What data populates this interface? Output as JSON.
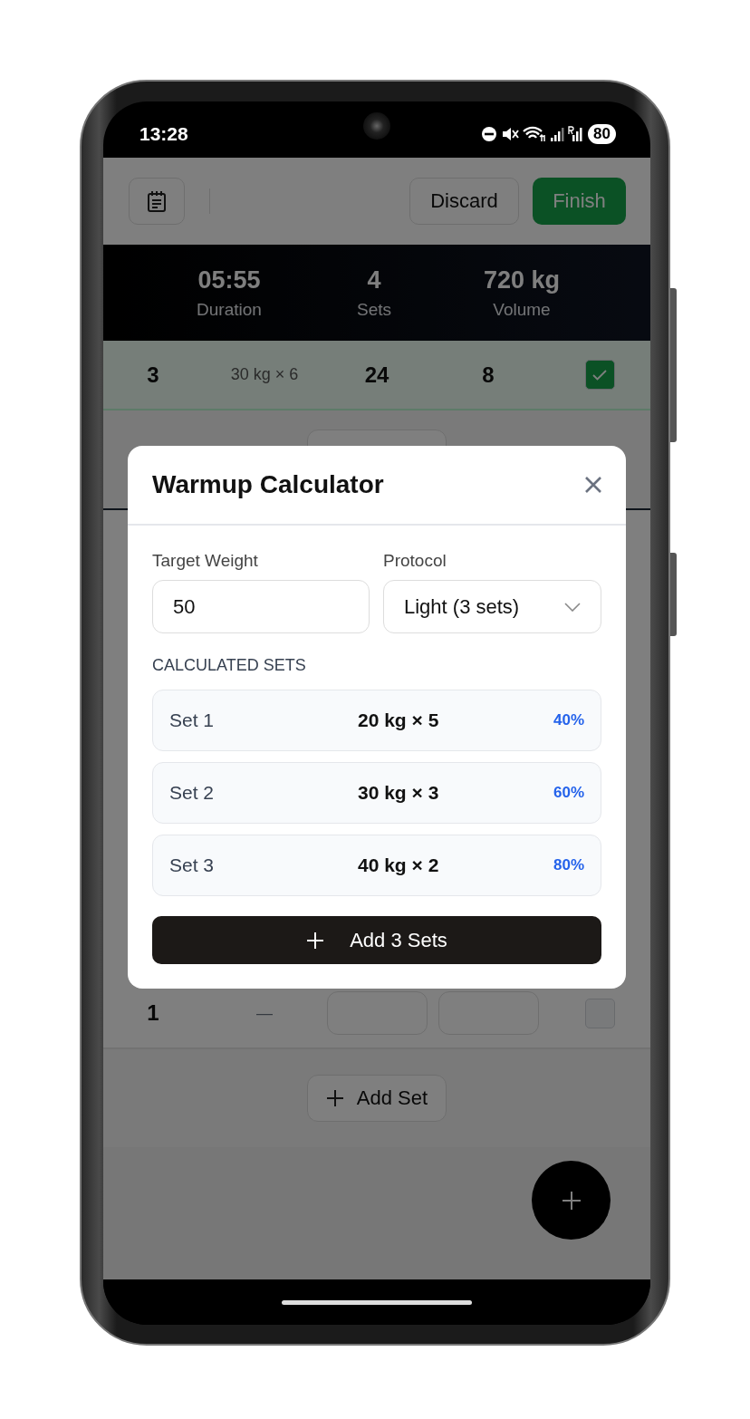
{
  "status_bar": {
    "time": "13:28",
    "battery": "80"
  },
  "header": {
    "buttons": [
      {
        "label": "Discard",
        "kind": "secondary"
      },
      {
        "label": "Finish",
        "kind": "primary"
      }
    ]
  },
  "stats": [
    {
      "value": "05:55",
      "label": "Duration"
    },
    {
      "value": "4",
      "label": "Sets"
    },
    {
      "value": "720 kg",
      "label": "Volume"
    }
  ],
  "sets_top": [
    {
      "set": "3",
      "previous": "30 kg × 6",
      "weight": "24",
      "reps": "8",
      "completed": true
    }
  ],
  "sets_bottom": [
    {
      "set": "1",
      "previous": "—",
      "completed": false
    }
  ],
  "add_set_button": "Add Set",
  "modal": {
    "title": "Warmup Calculator",
    "target_weight": {
      "label": "Target Weight",
      "value": "50"
    },
    "protocol": {
      "label": "Protocol",
      "value": "Light (3 sets)"
    },
    "section_title": "CALCULATED SETS",
    "sets": [
      {
        "label": "Set 1",
        "load": "20 kg × 5",
        "percent": "40%"
      },
      {
        "label": "Set 2",
        "load": "30 kg × 3",
        "percent": "60%"
      },
      {
        "label": "Set 3",
        "load": "40 kg × 2",
        "percent": "80%"
      }
    ],
    "add_button": "Add 3 Sets"
  }
}
